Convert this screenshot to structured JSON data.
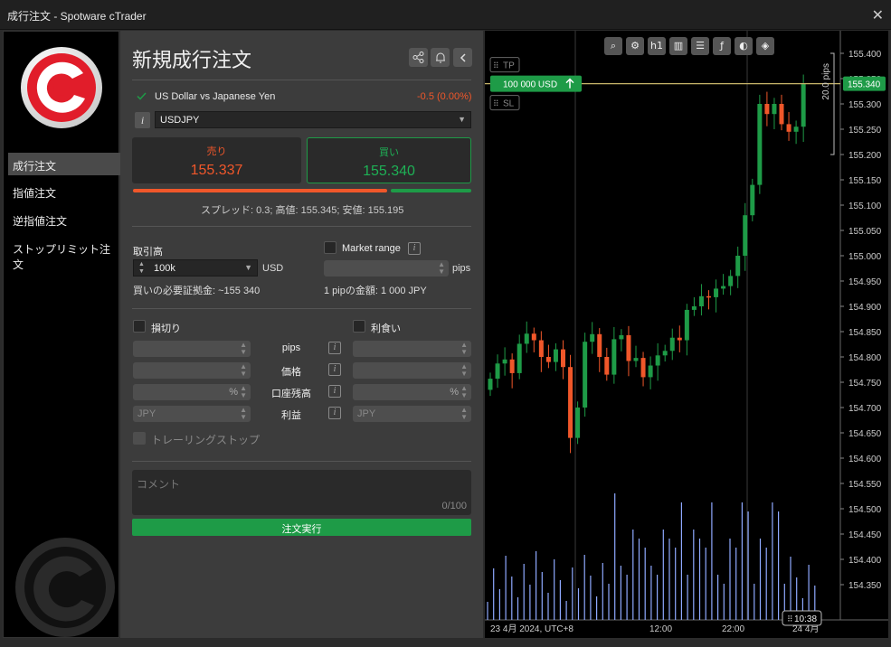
{
  "window": {
    "title": "成行注文 - Spotware cTrader",
    "close": "✕"
  },
  "sidebar": {
    "items": [
      {
        "label": "成行注文",
        "active": true
      },
      {
        "label": "指値注文"
      },
      {
        "label": "逆指値注文"
      },
      {
        "label": "ストップリミット注文"
      }
    ]
  },
  "panel": {
    "title": "新規成行注文",
    "instrument": {
      "name": "US Dollar vs Japanese Yen",
      "change": "-0.5 (0.00%)",
      "symbol": "USDJPY",
      "info": "i"
    },
    "sell": {
      "label": "売り",
      "price": "155.337"
    },
    "buy": {
      "label": "買い",
      "price": "155.340"
    },
    "spread_text": "スプレッド: 0.3; 高値: 155.345; 安値: 155.195",
    "volume": {
      "label": "取引高",
      "value": "100k",
      "unit": "USD",
      "margin": "買いの必要証拠金: ~155 340"
    },
    "market_range": {
      "label": "Market range",
      "unit": "pips",
      "pip_value": "1 pipの金額: 1 000 JPY"
    },
    "stop_loss": {
      "label": "損切り",
      "unit_pct": "%",
      "ccy": "JPY"
    },
    "take_profit": {
      "label": "利食い",
      "unit_pct": "%",
      "ccy": "JPY"
    },
    "mid_labels": [
      "pips",
      "価格",
      "口座残高",
      "利益"
    ],
    "trailing": "トレーリングストップ",
    "comment": {
      "placeholder": "コメント",
      "counter": "0/100"
    },
    "execute": "注文実行"
  },
  "chart": {
    "toolbar_icons": [
      "zoom-icon",
      "chart-settings-icon",
      "timeframe-h1-icon",
      "candles-icon",
      "checklist-icon",
      "fibonacci-icon",
      "sentiment-icon",
      "layers-icon"
    ],
    "timeframe": "h1",
    "tp_label": "TP",
    "sl_label": "SL",
    "order_tag": "100 000 USD",
    "pips_label": "20.0 pips",
    "current_price": "155.340",
    "price_axis": [
      "155.400",
      "155.350",
      "155.300",
      "155.250",
      "155.200",
      "155.150",
      "155.100",
      "155.050",
      "155.000",
      "154.950",
      "154.900",
      "154.850",
      "154.800",
      "154.750",
      "154.700",
      "154.650",
      "154.600",
      "154.550",
      "154.500",
      "154.450",
      "154.400",
      "154.350"
    ],
    "time_axis": [
      "23 4月 2024, UTC+8",
      "12:00",
      "22:00",
      "24 4月"
    ],
    "crosshair_time": "10:38",
    "colors": {
      "up": "#1e9b47",
      "down": "#f0572a",
      "volume": "#8fa9ff",
      "order_line": "#c8b66a"
    }
  }
}
